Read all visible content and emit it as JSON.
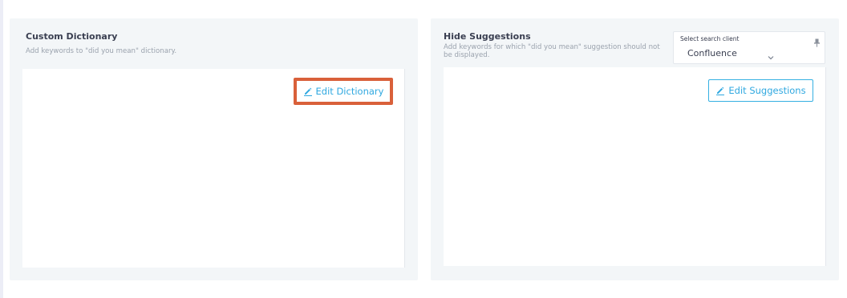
{
  "custom_dictionary": {
    "title": "Custom Dictionary",
    "description": "Add keywords to \"did you mean\" dictionary.",
    "edit_button_label": "Edit Dictionary",
    "edit_icon": "pencil-icon"
  },
  "hide_suggestions": {
    "title": "Hide Suggestions",
    "description": "Add keywords for which \"did you mean\" suggestion should not be displayed.",
    "edit_button_label": "Edit Suggestions",
    "edit_icon": "pencil-icon",
    "search_client": {
      "label": "Select search client",
      "value": "Confluence",
      "icons": [
        "chevron-down-icon",
        "pin-icon"
      ]
    }
  },
  "colors": {
    "accent": "#2fa8e0",
    "highlight": "#d9603a",
    "panel_bg": "#f3f6f8",
    "title_text": "#3a3f51",
    "muted_text": "#9aa2ad"
  }
}
